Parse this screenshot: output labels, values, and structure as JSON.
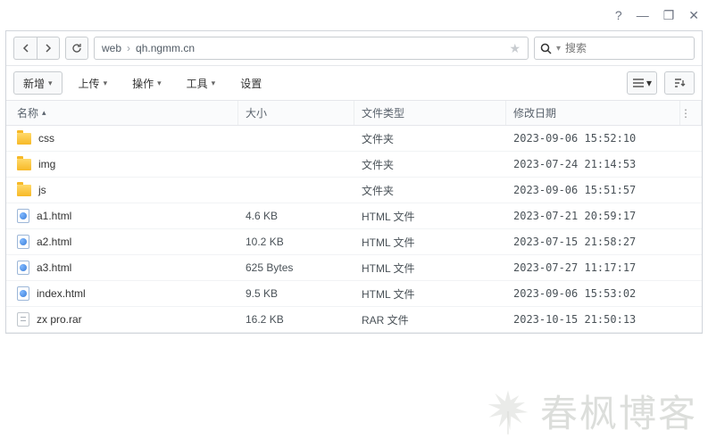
{
  "titlebar": {
    "help": "?",
    "minimize": "—",
    "maximize": "❐",
    "close": "✕"
  },
  "breadcrumb": {
    "items": [
      "web",
      "qh.ngmm.cn"
    ]
  },
  "search": {
    "placeholder": "搜索"
  },
  "toolbar": {
    "new": "新增",
    "upload": "上传",
    "action": "操作",
    "tools": "工具",
    "settings": "设置"
  },
  "columns": {
    "name": "名称",
    "size": "大小",
    "type": "文件类型",
    "date": "修改日期"
  },
  "rows": [
    {
      "icon": "folder",
      "name": "css",
      "size": "",
      "type": "文件夹",
      "date": "2023-09-06 15:52:10"
    },
    {
      "icon": "folder",
      "name": "img",
      "size": "",
      "type": "文件夹",
      "date": "2023-07-24 21:14:53"
    },
    {
      "icon": "folder",
      "name": "js",
      "size": "",
      "type": "文件夹",
      "date": "2023-09-06 15:51:57"
    },
    {
      "icon": "html",
      "name": "a1.html",
      "size": "4.6 KB",
      "type": "HTML 文件",
      "date": "2023-07-21 20:59:17"
    },
    {
      "icon": "html",
      "name": "a2.html",
      "size": "10.2 KB",
      "type": "HTML 文件",
      "date": "2023-07-15 21:58:27"
    },
    {
      "icon": "html",
      "name": "a3.html",
      "size": "625 Bytes",
      "type": "HTML 文件",
      "date": "2023-07-27 11:17:17"
    },
    {
      "icon": "html",
      "name": "index.html",
      "size": "9.5 KB",
      "type": "HTML 文件",
      "date": "2023-09-06 15:53:02"
    },
    {
      "icon": "rar",
      "name": "zx pro.rar",
      "size": "16.2 KB",
      "type": "RAR 文件",
      "date": "2023-10-15 21:50:13"
    }
  ],
  "watermark": "春枫博客"
}
